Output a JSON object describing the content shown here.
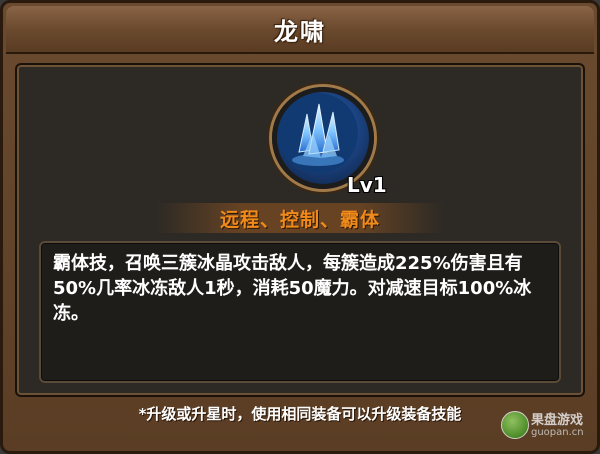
{
  "window": {
    "title": "龙啸"
  },
  "skill": {
    "icon": "ice-crystal-icon",
    "level": "Lv1",
    "tags": "远程、控制、霸体",
    "description": "霸体技，召唤三簇冰晶攻击敌人，每簇造成225%伤害且有50%几率冰冻敌人1秒，消耗50魔力。对减速目标100%冰冻。"
  },
  "footer": {
    "note": "*升级或升星时，使用相同装备可以升级装备技能"
  },
  "watermark": {
    "name": "果盘游戏",
    "url": "guopan.cn"
  },
  "colors": {
    "tag_color": "#f08a1a",
    "panel_brown": "#5a3d24",
    "inner_dark": "#2d2a25"
  }
}
